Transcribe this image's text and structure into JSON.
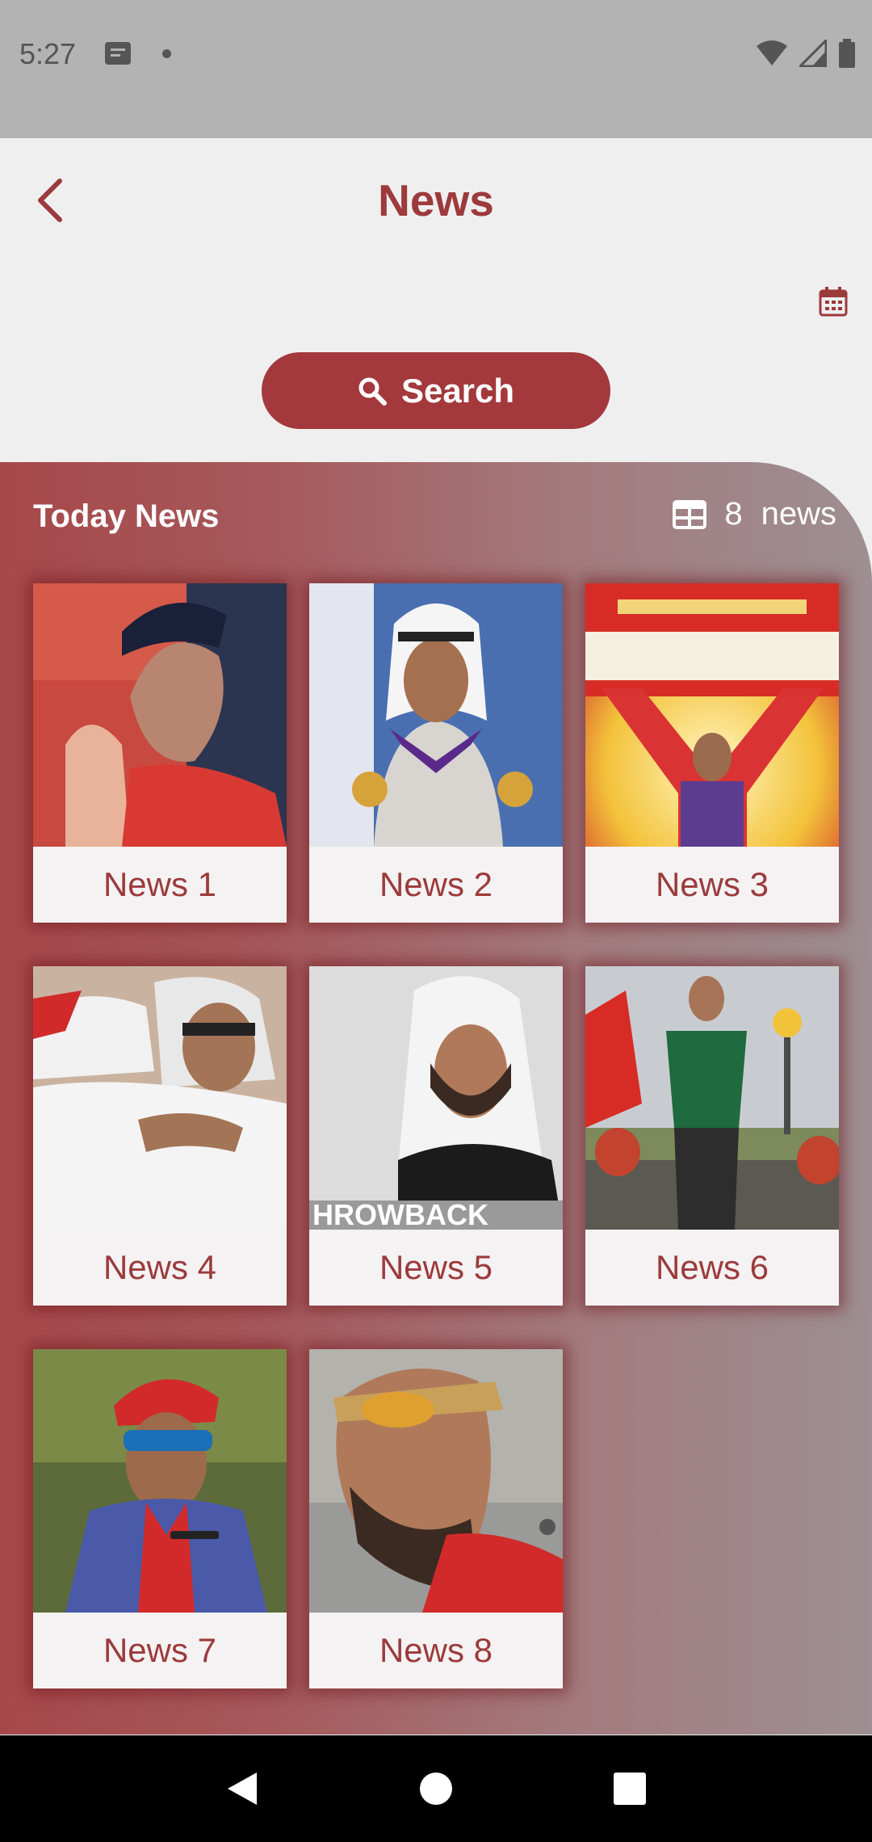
{
  "status_bar": {
    "time": "5:27"
  },
  "header": {
    "title": "News"
  },
  "search": {
    "label": "Search"
  },
  "section": {
    "title": "Today News",
    "count": "8",
    "count_unit": "news"
  },
  "colors": {
    "accent": "#a3393c",
    "title": "#9c3a3c"
  },
  "news_items": [
    {
      "label": "News 1",
      "thumb_icon": "photo-rider-waving"
    },
    {
      "label": "News 2",
      "thumb_icon": "photo-man-with-medals"
    },
    {
      "label": "News 3",
      "thumb_icon": "photo-champion-banner"
    },
    {
      "label": "News 4",
      "thumb_icon": "photo-men-hugging"
    },
    {
      "label": "News 5",
      "thumb_icon": "photo-throwback"
    },
    {
      "label": "News 6",
      "thumb_icon": "photo-winner-green-shirt"
    },
    {
      "label": "News 7",
      "thumb_icon": "photo-rider-red-cap"
    },
    {
      "label": "News 8",
      "thumb_icon": "photo-rider-sunglasses"
    }
  ]
}
